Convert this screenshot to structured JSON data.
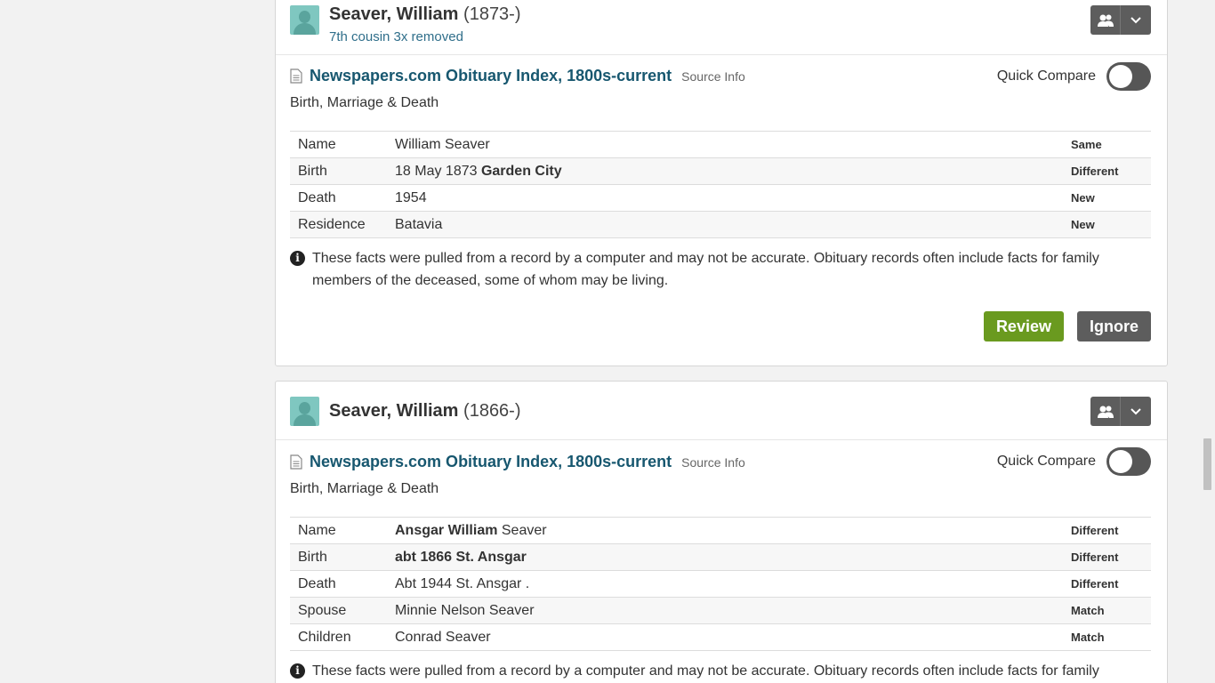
{
  "records": [
    {
      "person_name": "Seaver, William",
      "person_years": "(1873-)",
      "relationship": "7th cousin 3x removed",
      "source_title": "Newspapers.com Obituary Index, 1800s-current",
      "source_info": "Source Info",
      "category": "Birth, Marriage & Death",
      "quick_compare": "Quick Compare",
      "facts": [
        {
          "label": "Name",
          "value_bold": "",
          "value": "William Seaver",
          "status": "Same"
        },
        {
          "label": "Birth",
          "value": "18 May 1873 ",
          "value_bold": "Garden City",
          "status": "Different"
        },
        {
          "label": "Death",
          "value_bold": "",
          "value": "1954",
          "status": "New"
        },
        {
          "label": "Residence",
          "value_bold": "",
          "value": "Batavia",
          "status": "New"
        }
      ],
      "note": "These facts were pulled from a record by a computer and may not be accurate. Obituary records often include facts for family members of the deceased, some of whom may be living.",
      "review_label": "Review",
      "ignore_label": "Ignore"
    },
    {
      "person_name": "Seaver, William",
      "person_years": "(1866-)",
      "source_title": "Newspapers.com Obituary Index, 1800s-current",
      "source_info": "Source Info",
      "category": "Birth, Marriage & Death",
      "quick_compare": "Quick Compare",
      "facts": [
        {
          "label": "Name",
          "value_bold": "Ansgar William",
          "value": " Seaver",
          "status": "Different"
        },
        {
          "label": "Birth",
          "value_bold": "abt 1866 St. Ansgar",
          "value": "",
          "status": "Different"
        },
        {
          "label": "Death",
          "value_bold": "",
          "value": "Abt 1944 St. Ansgar .",
          "status": "Different"
        },
        {
          "label": "Spouse",
          "value_bold": "",
          "value": "Minnie Nelson Seaver",
          "status": "Match"
        },
        {
          "label": "Children",
          "value_bold": "",
          "value": "Conrad Seaver",
          "status": "Match"
        }
      ],
      "note": "These facts were pulled from a record by a computer and may not be accurate. Obituary records often include facts for family"
    }
  ]
}
